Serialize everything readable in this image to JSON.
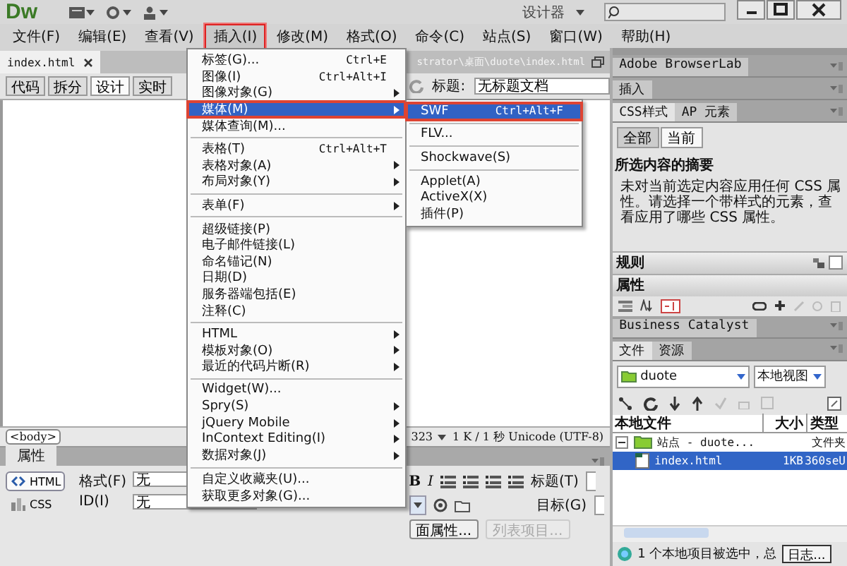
{
  "window": {
    "logo": "Dw",
    "workspace": "设计器"
  },
  "menubar": [
    {
      "label": "文件(F)",
      "selected": false
    },
    {
      "label": "编辑(E)",
      "selected": false
    },
    {
      "label": "查看(V)",
      "selected": false
    },
    {
      "label": "插入(I)",
      "selected": true
    },
    {
      "label": "修改(M)",
      "selected": false
    },
    {
      "label": "格式(O)",
      "selected": false
    },
    {
      "label": "命令(C)",
      "selected": false
    },
    {
      "label": "站点(S)",
      "selected": false
    },
    {
      "label": "窗口(W)",
      "selected": false
    },
    {
      "label": "帮助(H)",
      "selected": false
    }
  ],
  "document": {
    "tab": "index.html",
    "path": "strator\\桌面\\duote\\index.html",
    "view_buttons": [
      {
        "label": "代码",
        "selected": false
      },
      {
        "label": "拆分",
        "selected": false
      },
      {
        "label": "设计",
        "selected": true
      },
      {
        "label": "实时",
        "selected": false
      }
    ],
    "title_label": "标题:",
    "title_value": "无标题文档"
  },
  "status_bar": {
    "tag": "<body>",
    "size": "323",
    "info": "1 K / 1 秒 Unicode (UTF-8)"
  },
  "properties": {
    "title": "属性",
    "modes": [
      {
        "label": "HTML",
        "selected": true
      },
      {
        "label": "CSS",
        "selected": false
      }
    ],
    "fields": [
      {
        "label": "格式(F)",
        "value": "无"
      },
      {
        "label": "ID(I)",
        "value": "无"
      }
    ],
    "bold": "B",
    "italic": "I",
    "heading_label": "标题(T)",
    "target_label": "目标(G)",
    "page_properties": "面属性...",
    "list_item": "列表项目..."
  },
  "panels": {
    "browserlab": "Adobe BrowserLab",
    "insert": "插入",
    "css_tabs": [
      {
        "label": "CSS样式",
        "selected": true
      },
      {
        "label": "AP 元素",
        "selected": false
      }
    ],
    "css_modes": [
      {
        "label": "全部",
        "selected": false
      },
      {
        "label": "当前",
        "selected": true
      }
    ],
    "summary_title": "所选内容的摘要",
    "summary_text": "未对当前选定内容应用任何 CSS 属性。请选择一个带样式的元素，查看应用了哪些 CSS 属性。",
    "rules": "规则",
    "properties": "属性",
    "business_catalyst": "Business Catalyst",
    "files_tabs": [
      {
        "label": "文件",
        "selected": true
      },
      {
        "label": "资源",
        "selected": false
      }
    ],
    "site": "duote",
    "view": "本地视图",
    "columns": [
      "本地文件",
      "大小",
      "类型"
    ],
    "rows": [
      {
        "name": "站点 - duote...",
        "type": "文件夹",
        "expanded": true,
        "selected": false,
        "children": [
          {
            "name": "index.html",
            "size": "1KB",
            "type": "360seU",
            "selected": true
          }
        ]
      }
    ],
    "status": "1 个本地项目被选中，总",
    "log_button": "日志..."
  },
  "insert_menu": {
    "groups": [
      {
        "items": [
          {
            "label": "标签(G)...",
            "shortcut": "Ctrl+E",
            "submenu": false,
            "selected": false
          },
          {
            "label": "图像(I)",
            "shortcut": "Ctrl+Alt+I",
            "submenu": false,
            "selected": false
          },
          {
            "label": "图像对象(G)",
            "submenu": true,
            "selected": false
          },
          {
            "label": "媒体(M)",
            "submenu": true,
            "selected": true
          },
          {
            "label": "媒体查询(M)...",
            "submenu": false,
            "selected": false
          }
        ]
      },
      {
        "items": [
          {
            "label": "表格(T)",
            "shortcut": "Ctrl+Alt+T",
            "submenu": false,
            "selected": false
          },
          {
            "label": "表格对象(A)",
            "submenu": true,
            "selected": false
          },
          {
            "label": "布局对象(Y)",
            "submenu": true,
            "selected": false
          }
        ]
      },
      {
        "items": [
          {
            "label": "表单(F)",
            "submenu": true,
            "selected": false
          }
        ]
      },
      {
        "items": [
          {
            "label": "超级链接(P)",
            "submenu": false,
            "selected": false
          },
          {
            "label": "电子邮件链接(L)",
            "submenu": false,
            "selected": false
          },
          {
            "label": "命名锚记(N)",
            "submenu": false,
            "selected": false
          },
          {
            "label": "日期(D)",
            "submenu": false,
            "selected": false
          },
          {
            "label": "服务器端包括(E)",
            "submenu": false,
            "selected": false
          },
          {
            "label": "注释(C)",
            "submenu": false,
            "selected": false
          }
        ]
      },
      {
        "items": [
          {
            "label": "HTML",
            "submenu": true,
            "selected": false
          },
          {
            "label": "模板对象(O)",
            "submenu": true,
            "selected": false
          },
          {
            "label": "最近的代码片断(R)",
            "submenu": true,
            "selected": false
          }
        ]
      },
      {
        "items": [
          {
            "label": "Widget(W)...",
            "submenu": false,
            "selected": false
          },
          {
            "label": "Spry(S)",
            "submenu": true,
            "selected": false
          },
          {
            "label": "jQuery Mobile",
            "submenu": true,
            "selected": false
          },
          {
            "label": "InContext Editing(I)",
            "submenu": true,
            "selected": false
          },
          {
            "label": "数据对象(J)",
            "submenu": true,
            "selected": false
          }
        ]
      },
      {
        "items": [
          {
            "label": "自定义收藏夹(U)...",
            "submenu": false,
            "selected": false
          },
          {
            "label": "获取更多对象(G)...",
            "submenu": false,
            "selected": false
          }
        ]
      }
    ]
  },
  "media_submenu": {
    "groups": [
      {
        "items": [
          {
            "label": "SWF",
            "shortcut": "Ctrl+Alt+F",
            "submenu": false,
            "selected": true
          }
        ]
      },
      {
        "items": [
          {
            "label": "FLV...",
            "submenu": false,
            "selected": false
          }
        ]
      },
      {
        "items": [
          {
            "label": "Shockwave(S)",
            "submenu": false,
            "selected": false
          }
        ]
      },
      {
        "items": [
          {
            "label": "Applet(A)",
            "submenu": false,
            "selected": false
          },
          {
            "label": "ActiveX(X)",
            "submenu": false,
            "selected": false
          },
          {
            "label": "插件(P)",
            "submenu": false,
            "selected": false
          }
        ]
      }
    ]
  }
}
